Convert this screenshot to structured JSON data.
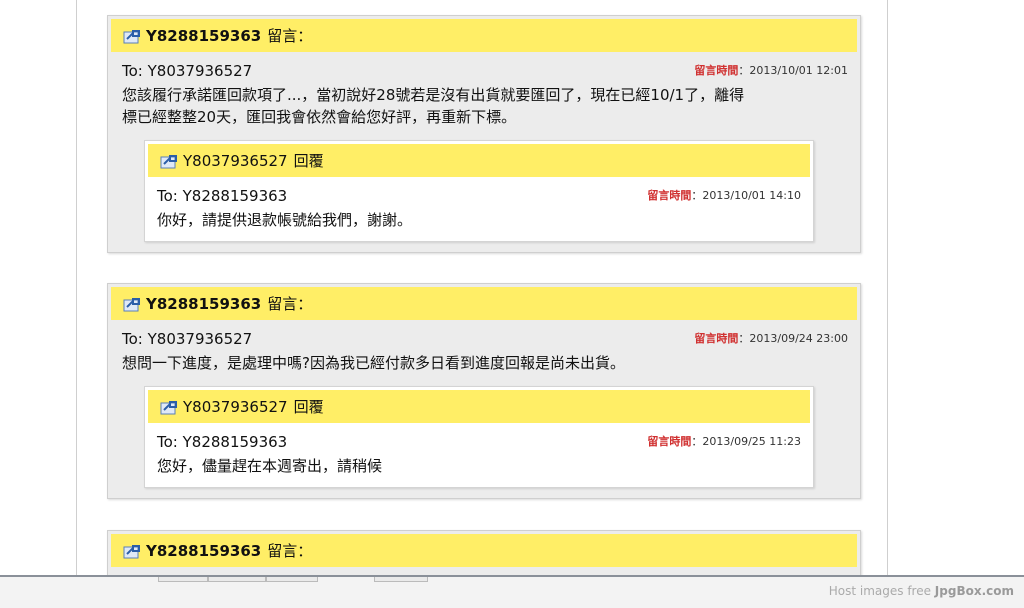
{
  "threads": [
    {
      "header": {
        "sender": "Y8288159363",
        "action": "留言："
      },
      "to": "To: Y8037936527",
      "time_label": "留言時間",
      "time_value": "：2013/10/01 12:01",
      "text_line1": "您該履行承諾匯回款項了...，當初說好28號若是沒有出貨就要匯回了，現在已經10/1了，離得",
      "text_line2": "標已經整整20天，匯回我會依然會給您好評，再重新下標。",
      "reply": {
        "sender": "Y8037936527",
        "action": "回覆",
        "to": "To: Y8288159363",
        "time_label": "留言時間",
        "time_value": "：2013/10/01 14:10",
        "text": "你好，請提供退款帳號給我們，謝謝。"
      }
    },
    {
      "header": {
        "sender": "Y8288159363",
        "action": "留言："
      },
      "to": "To: Y8037936527",
      "time_label": "留言時間",
      "time_value": "：2013/09/24 23:00",
      "text_line1": "想問一下進度，是處理中嗎?因為我已經付款多日看到進度回報是尚未出貨。",
      "reply": {
        "sender": "Y8037936527",
        "action": "回覆",
        "to": "To: Y8288159363",
        "time_label": "留言時間",
        "time_value": "：2013/09/25 11:23",
        "text": "您好，儘量趕在本週寄出，請稍候"
      }
    },
    {
      "header": {
        "sender": "Y8288159363",
        "action": "留言："
      }
    }
  ],
  "footer": {
    "prefix": "Host images free ",
    "brand": "JpgBox.com"
  },
  "colors": {
    "header_yellow": "#ffee66",
    "time_label_red": "#d03030"
  },
  "icons": {
    "reply": "reply-arrow-icon"
  }
}
